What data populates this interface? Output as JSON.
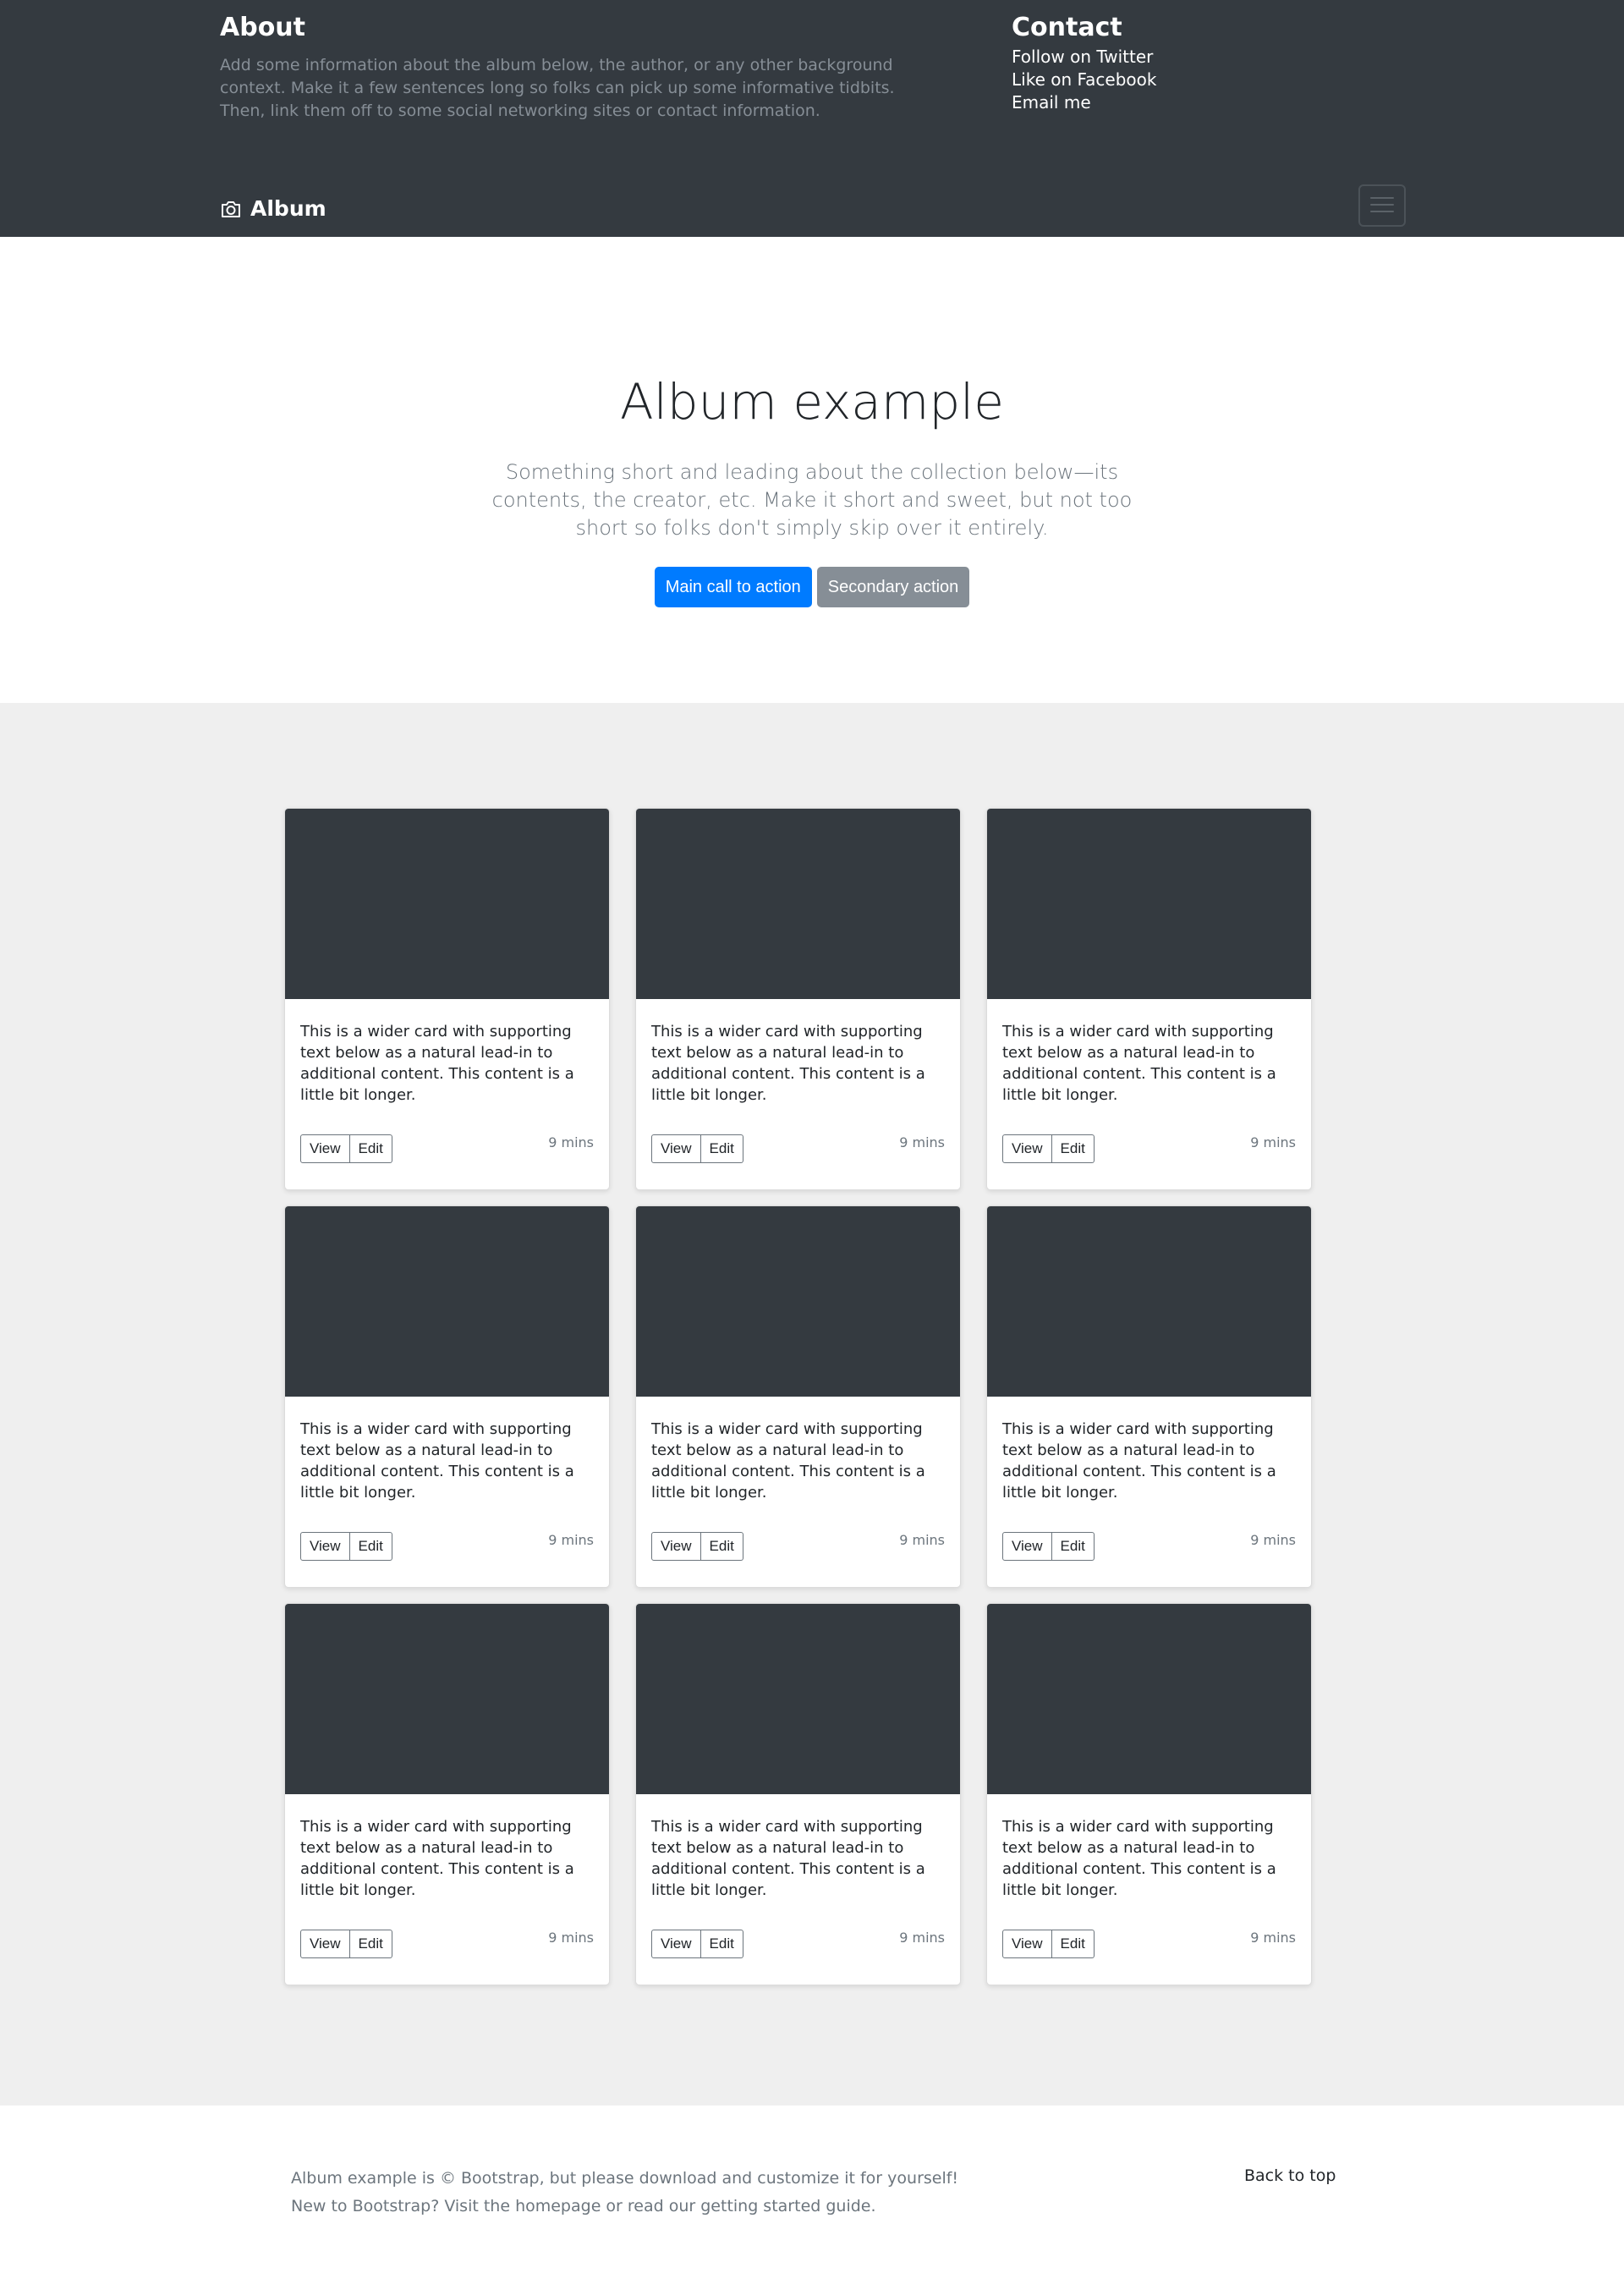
{
  "header": {
    "about_title": "About",
    "about_text": "Add some information about the album below, the author, or any other background context. Make it a few sentences long so folks can pick up some informative tidbits. Then, link them off to some social networking sites or contact information.",
    "contact_title": "Contact",
    "contact_links": [
      "Follow on Twitter",
      "Like on Facebook",
      "Email me"
    ],
    "brand": "Album",
    "brand_icon": "camera-icon",
    "toggler_icon": "hamburger-menu-icon"
  },
  "jumbotron": {
    "title": "Album example",
    "lead": "Something short and leading about the collection below—its contents, the creator, etc. Make it short and sweet, but not too short so folks don't simply skip over it entirely.",
    "primary_label": "Main call to action",
    "secondary_label": "Secondary action"
  },
  "cards": [
    {
      "text": "This is a wider card with supporting text below as a natural lead-in to additional content. This content is a little bit longer.",
      "view": "View",
      "edit": "Edit",
      "time": "9 mins"
    },
    {
      "text": "This is a wider card with supporting text below as a natural lead-in to additional content. This content is a little bit longer.",
      "view": "View",
      "edit": "Edit",
      "time": "9 mins"
    },
    {
      "text": "This is a wider card with supporting text below as a natural lead-in to additional content. This content is a little bit longer.",
      "view": "View",
      "edit": "Edit",
      "time": "9 mins"
    },
    {
      "text": "This is a wider card with supporting text below as a natural lead-in to additional content. This content is a little bit longer.",
      "view": "View",
      "edit": "Edit",
      "time": "9 mins"
    },
    {
      "text": "This is a wider card with supporting text below as a natural lead-in to additional content. This content is a little bit longer.",
      "view": "View",
      "edit": "Edit",
      "time": "9 mins"
    },
    {
      "text": "This is a wider card with supporting text below as a natural lead-in to additional content. This content is a little bit longer.",
      "view": "View",
      "edit": "Edit",
      "time": "9 mins"
    },
    {
      "text": "This is a wider card with supporting text below as a natural lead-in to additional content. This content is a little bit longer.",
      "view": "View",
      "edit": "Edit",
      "time": "9 mins"
    },
    {
      "text": "This is a wider card with supporting text below as a natural lead-in to additional content. This content is a little bit longer.",
      "view": "View",
      "edit": "Edit",
      "time": "9 mins"
    },
    {
      "text": "This is a wider card with supporting text below as a natural lead-in to additional content. This content is a little bit longer.",
      "view": "View",
      "edit": "Edit",
      "time": "9 mins"
    }
  ],
  "footer": {
    "line1": "Album example is © Bootstrap, but please download and customize it for yourself!",
    "line2": "New to Bootstrap? Visit the homepage or read our getting started guide.",
    "back_to_top": "Back to top"
  },
  "colors": {
    "header_bg": "#343a40",
    "primary": "#007bff",
    "secondary": "#868e96",
    "album_bg": "#efefef",
    "card_image": "#343a40"
  }
}
